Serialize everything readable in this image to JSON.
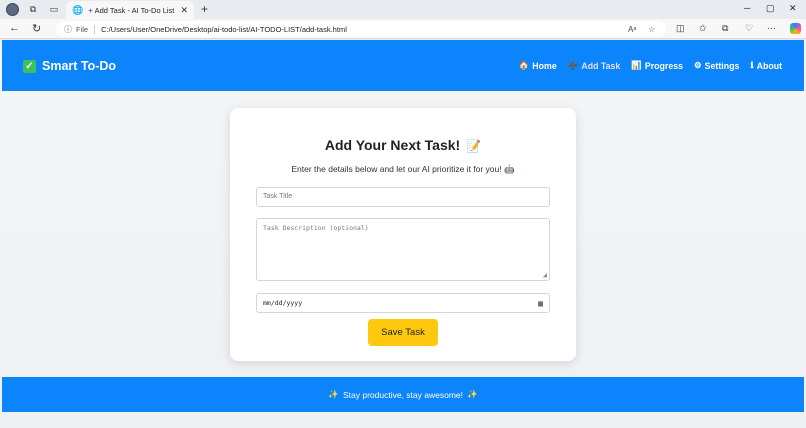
{
  "browser": {
    "tab_title": "Add Task - AI To-Do List",
    "file_label": "File",
    "url": "C:/Users/User/OneDrive/Desktop/ai-todo-list/AI-TODO-LIST/add-task.html"
  },
  "header": {
    "brand": "Smart To-Do",
    "nav": [
      {
        "icon": "🏠",
        "label": "Home"
      },
      {
        "icon": "➕",
        "label": "Add Task"
      },
      {
        "icon": "📊",
        "label": "Progress"
      },
      {
        "icon": "⚙",
        "label": "Settings"
      },
      {
        "icon": "ℹ",
        "label": "About"
      }
    ]
  },
  "form": {
    "title": "Add Your Next Task!",
    "subtitle": "Enter the details below and let our AI prioritize it for you!",
    "title_placeholder": "Task Title",
    "description_placeholder": "Task Description (optional)",
    "date_value": "mm/dd/yyyy",
    "save_label": "Save Task"
  },
  "footer": {
    "text": "Stay productive, stay awesome!"
  },
  "colors": {
    "primary": "#0b84fc",
    "button": "#fec90d"
  }
}
